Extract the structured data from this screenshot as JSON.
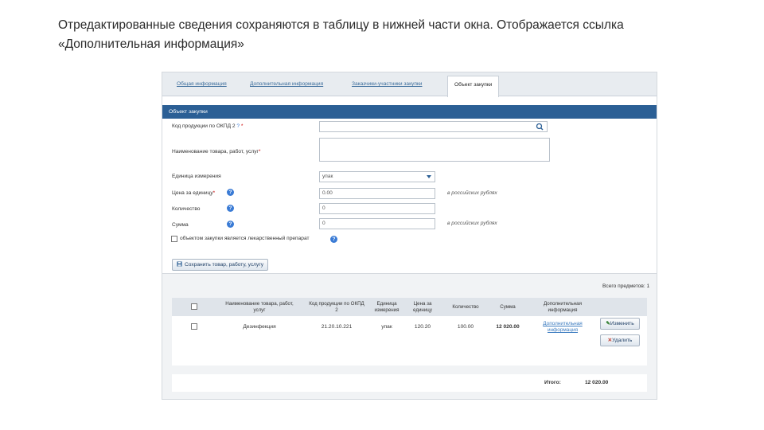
{
  "caption": {
    "line1": "Отредактированные сведения сохраняются в таблицу в нижней части окна. Отображается ссылка",
    "line2": "«Дополнительная информация»"
  },
  "tabs": [
    {
      "label": "Общая информация",
      "active": false
    },
    {
      "label": "Дополнительная информация",
      "active": false
    },
    {
      "label": "Заказчики-участники закупки",
      "active": false
    },
    {
      "label": "Объект закупки",
      "active": true
    }
  ],
  "section_title": "Объект закупки",
  "form": {
    "okpd_label": "Код продукции по ОКПД 2",
    "okpd_value": "",
    "name_label": "Наименование товара, работ, услуг",
    "name_value": "",
    "unit_label": "Единица измерения",
    "unit_value": "упак",
    "price_label": "Цена за единицу",
    "price_value": "0.00",
    "price_unit": "в российских рублях",
    "qty_label": "Количество",
    "qty_value": "0",
    "sum_label": "Сумма",
    "sum_value": "0",
    "sum_unit": "в российских рублях",
    "drug_checkbox_label": "объектом закупки является лекарственный препарат",
    "save_button": "Сохранить товар, работу, услугу"
  },
  "table": {
    "total_items": "Всего предметов: 1",
    "headers": [
      "Наименование товара, работ, услуг",
      "Код продукции по ОКПД 2",
      "Единица измерения",
      "Цена за единицу",
      "Количество",
      "Сумма",
      "Дополнительная информация"
    ],
    "rows": [
      {
        "name": "Дезинфекция",
        "code": "21.20.10.221",
        "unit": "упак",
        "price": "120.20",
        "qty": "100.00",
        "sum": "12 020.00",
        "info_link": "Дополнительная информация",
        "edit_button": "Изменить",
        "delete_button": "Удалить"
      }
    ],
    "total_label": "Итого:",
    "total_value": "12 020.00"
  },
  "colors": {
    "section_bar": "#2b5f95",
    "link": "#3d7cc0",
    "help_icon": "#3a7bd5"
  }
}
